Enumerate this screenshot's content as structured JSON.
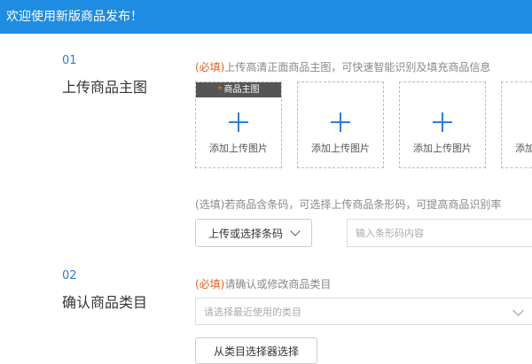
{
  "header": {
    "title": "欢迎使用新版商品发布！"
  },
  "step1": {
    "number": "01",
    "title": "上传商品主图",
    "required_tag": "(必填)",
    "hint": "上传高清正面商品主图，可快速智能识别及填充商品信息",
    "main_image_tag": "商品主图",
    "main_image_star": "*",
    "upload_label": "添加上传图片",
    "barcode_hint": "(选填)若商品含条码，可选择上传商品条形码，可提高商品识别率",
    "barcode_button": "上传或选择条码",
    "barcode_placeholder": "输入条形码内容"
  },
  "step2": {
    "number": "02",
    "title": "确认商品类目",
    "required_tag": "(必填)",
    "hint": "请确认或修改商品类目",
    "category_placeholder": "请选择最近使用的类目",
    "selector_button": "从类目选择器选择"
  },
  "colors": {
    "header_bg": "#1e8ce0",
    "accent": "#2b7ed8",
    "required": "#e8601c"
  }
}
